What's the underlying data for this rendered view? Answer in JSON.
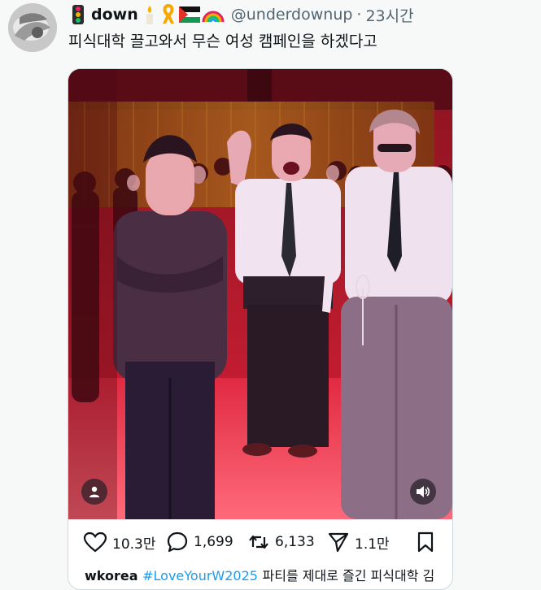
{
  "user": {
    "display_name": "down",
    "emojis": [
      "traffic-light-icon",
      "candle-icon",
      "ribbon-icon",
      "palestine-flag-icon",
      "rainbow-icon"
    ],
    "handle": "@underdownup",
    "separator": "·",
    "time": "23시간"
  },
  "tweet_text": "피식대학 끌고와서 무슨 여성 캠페인을 하겠다고",
  "media": {
    "person_button_icon": "person-icon",
    "volume_button_icon": "volume-icon"
  },
  "actions": {
    "likes": "10.3만",
    "replies": "1,699",
    "retweets": "6,133",
    "shares": "1.1만"
  },
  "caption": {
    "account": "wkorea",
    "hashtag": "#LoveYourW2025",
    "text": "파티를 제대로 즐긴 피식대학 김"
  },
  "colors": {
    "accent_blue": "#1d9bf0",
    "muted_text": "#536471",
    "border": "#cfd9de"
  }
}
